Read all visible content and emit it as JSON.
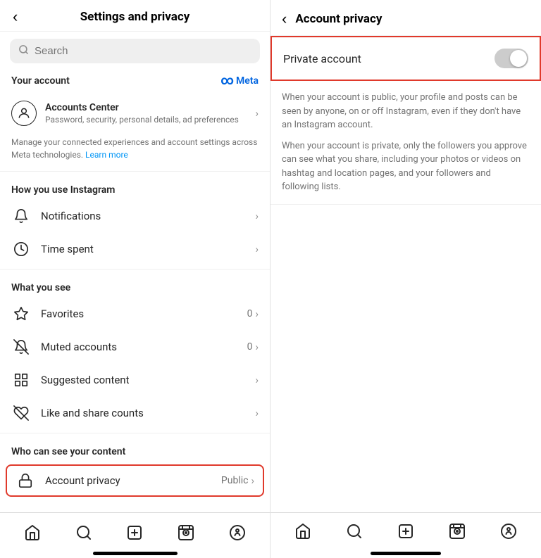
{
  "left": {
    "header": {
      "back_label": "‹",
      "title": "Settings and privacy"
    },
    "search": {
      "placeholder": "Search"
    },
    "your_account_label": "Your account",
    "meta_label": "Meta",
    "accounts_center": {
      "name": "Accounts Center",
      "subtitle": "Password, security, personal details, ad preferences",
      "chevron": "›"
    },
    "manage_text": "Manage your connected experiences and account settings across Meta technologies.",
    "learn_more": "Learn more",
    "how_you_use_label": "How you use Instagram",
    "notifications": {
      "label": "Notifications",
      "chevron": "›"
    },
    "time_spent": {
      "label": "Time spent",
      "chevron": "›"
    },
    "what_you_see_label": "What you see",
    "favorites": {
      "label": "Favorites",
      "badge": "0",
      "chevron": "›"
    },
    "muted_accounts": {
      "label": "Muted accounts",
      "badge": "0",
      "chevron": "›"
    },
    "suggested_content": {
      "label": "Suggested content",
      "chevron": "›"
    },
    "like_share": {
      "label": "Like and share counts",
      "chevron": "›"
    },
    "who_can_see_label": "Who can see your content",
    "account_privacy": {
      "label": "Account privacy",
      "value": "Public",
      "chevron": "›"
    }
  },
  "right": {
    "header": {
      "back_label": "‹",
      "title": "Account privacy"
    },
    "private_account": {
      "label": "Private account"
    },
    "description_1": "When your account is public, your profile and posts can be seen by anyone, on or off Instagram, even if they don't have an Instagram account.",
    "description_2": "When your account is private, only the followers you approve can see what you share, including your photos or videos on hashtag and location pages, and your followers and following lists."
  },
  "nav": {
    "home": "⌂",
    "search": "🔍",
    "add": "+",
    "reels": "▶",
    "profile": "○"
  }
}
